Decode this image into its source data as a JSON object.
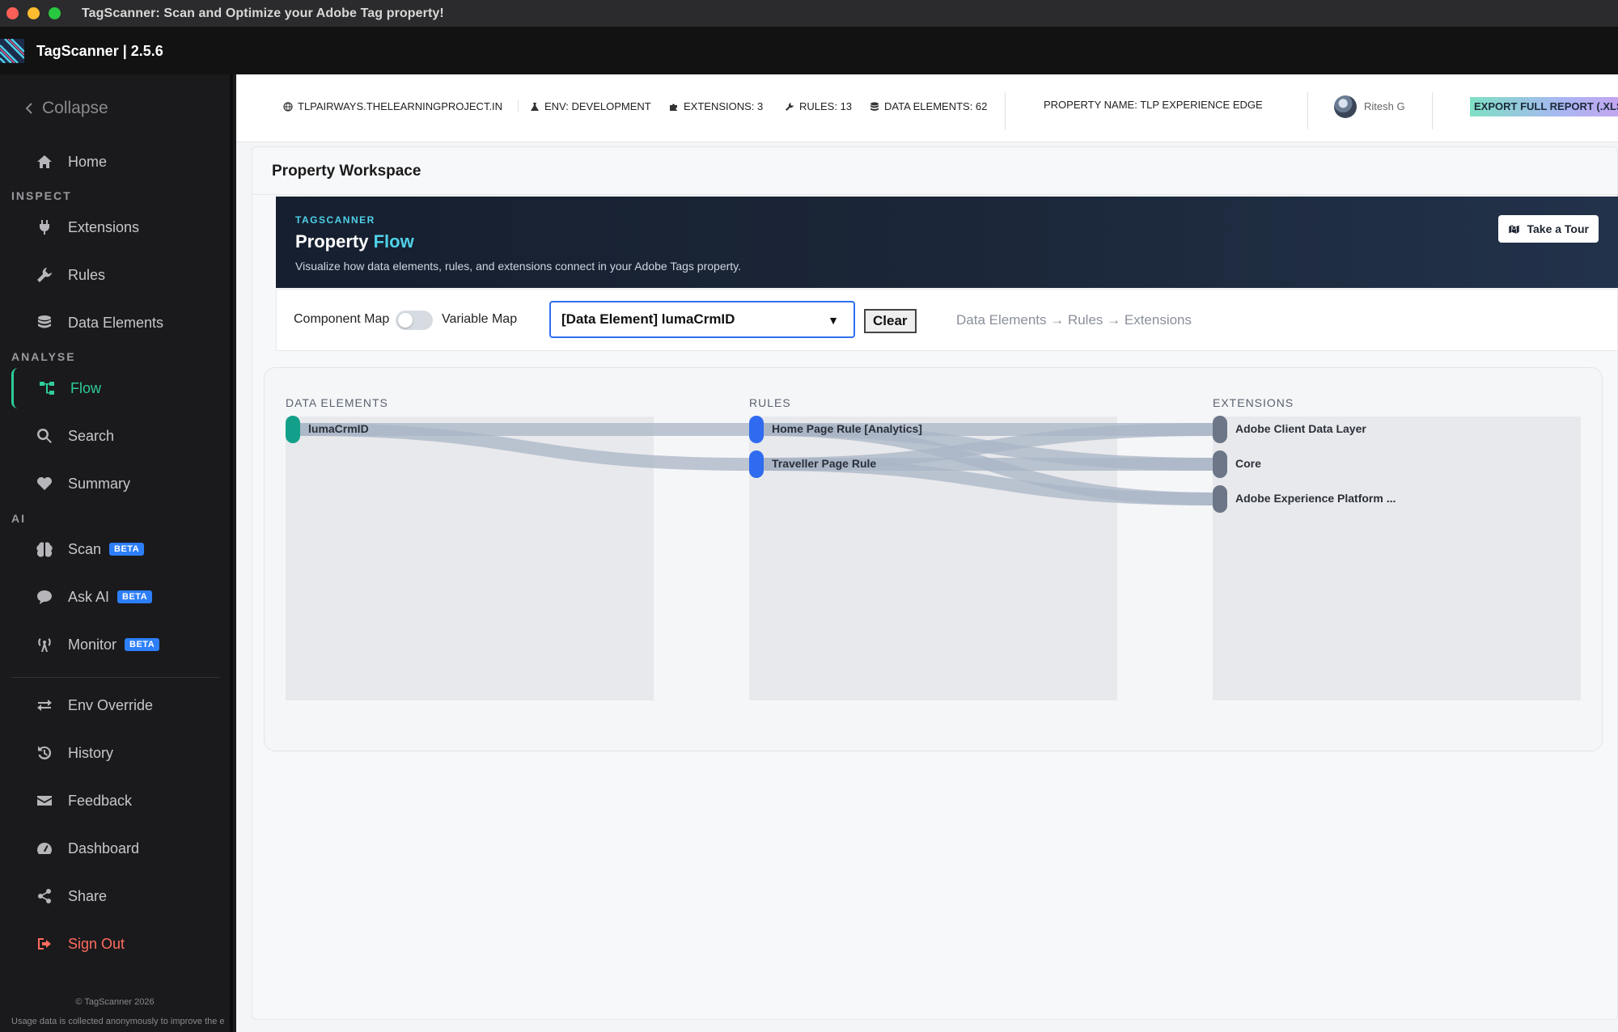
{
  "window": {
    "title": "TagScanner: Scan and Optimize your Adobe Tag property!"
  },
  "app": {
    "name": "TagScanner | 2.5.6"
  },
  "sidebar": {
    "collapse": "Collapse",
    "items": {
      "home": "Home",
      "extensions": "Extensions",
      "rules": "Rules",
      "data_elements": "Data Elements",
      "flow": "Flow",
      "search": "Search",
      "summary": "Summary",
      "scan": "Scan",
      "ask_ai": "Ask AI",
      "monitor": "Monitor",
      "env_override": "Env Override",
      "history": "History",
      "feedback": "Feedback",
      "dashboard": "Dashboard",
      "share": "Share",
      "sign_out": "Sign Out"
    },
    "sections": {
      "inspect": "INSPECT",
      "analyse": "ANALYSE",
      "ai": "AI"
    },
    "beta": "BETA",
    "footer_copyright": "© TagScanner 2026",
    "footer_notice": "Usage data is collected anonymously to improve the e"
  },
  "topbar": {
    "domain": "TLPAIRWAYS.THELEARNINGPROJECT.IN",
    "env": "ENV: DEVELOPMENT",
    "extensions": "EXTENSIONS: 3",
    "rules": "RULES: 13",
    "data_elements": "DATA ELEMENTS: 62",
    "property_name": "PROPERTY NAME: TLP EXPERIENCE EDGE",
    "user": "Ritesh G",
    "export": "EXPORT FULL REPORT (.XLS"
  },
  "workspace": {
    "title": "Property Workspace"
  },
  "hero": {
    "kicker": "TAGSCANNER",
    "title_main": "Property ",
    "title_accent": "Flow",
    "subtitle": "Visualize how data elements, rules, and extensions connect in your Adobe Tags property.",
    "tour_button": "Take a Tour"
  },
  "controls": {
    "component_map": "Component Map",
    "variable_map": "Variable Map",
    "selected": "[Data Element] lumaCrmID",
    "clear": "Clear",
    "breadcrumb": "Data Elements → Rules → Extensions"
  },
  "flow": {
    "columns": {
      "data_elements": "DATA ELEMENTS",
      "rules": "RULES",
      "extensions": "EXTENSIONS"
    },
    "data_elements": [
      "lumaCrmID"
    ],
    "rules": [
      "Home Page Rule [Analytics]",
      "Traveller Page Rule"
    ],
    "extensions": [
      "Adobe Client Data Layer",
      "Core",
      "Adobe Experience Platform ..."
    ],
    "links": [
      {
        "from": "lumaCrmID",
        "to": "Home Page Rule [Analytics]"
      },
      {
        "from": "lumaCrmID",
        "to": "Traveller Page Rule"
      },
      {
        "from": "Home Page Rule [Analytics]",
        "to": "Adobe Client Data Layer"
      },
      {
        "from": "Home Page Rule [Analytics]",
        "to": "Core"
      },
      {
        "from": "Home Page Rule [Analytics]",
        "to": "Adobe Experience Platform ..."
      },
      {
        "from": "Traveller Page Rule",
        "to": "Adobe Client Data Layer"
      },
      {
        "from": "Traveller Page Rule",
        "to": "Core"
      },
      {
        "from": "Traveller Page Rule",
        "to": "Adobe Experience Platform ..."
      }
    ]
  },
  "colors": {
    "accent_green": "#2ecc9a",
    "accent_cyan": "#4fd1e8",
    "node_data_element": "#12a08a",
    "node_rule": "#2f6bf0",
    "node_extension": "#6d7687",
    "sign_out": "#ff6b5e"
  }
}
